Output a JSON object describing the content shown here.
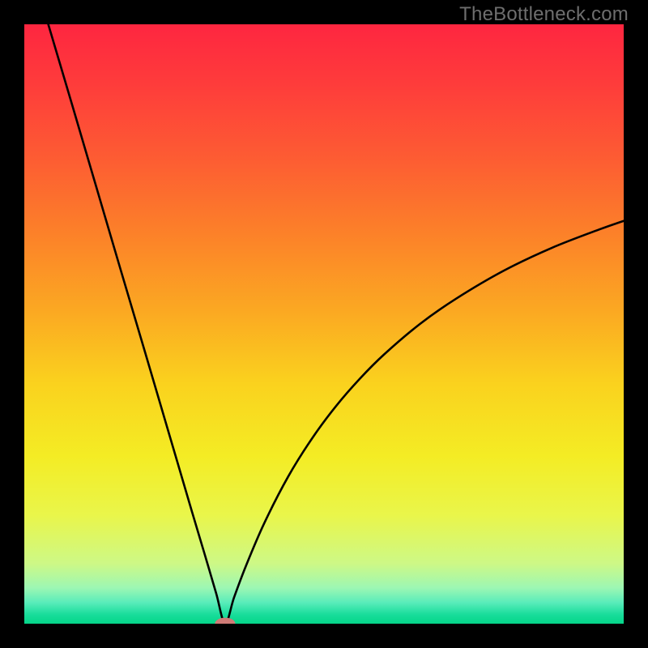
{
  "watermark": "TheBottleneck.com",
  "chart_data": {
    "type": "line",
    "title": "",
    "xlabel": "",
    "ylabel": "",
    "xlim": [
      0,
      1
    ],
    "ylim": [
      0,
      1
    ],
    "x_min_at": 0.335,
    "series": [
      {
        "name": "curve",
        "color": "#000000",
        "x": [
          0.04,
          0.08,
          0.12,
          0.16,
          0.2,
          0.24,
          0.28,
          0.3,
          0.32,
          0.335,
          0.35,
          0.37,
          0.4,
          0.44,
          0.48,
          0.52,
          0.56,
          0.6,
          0.66,
          0.72,
          0.8,
          0.88,
          0.96,
          1.0
        ],
        "y": [
          1.0,
          0.865,
          0.729,
          0.593,
          0.458,
          0.322,
          0.186,
          0.119,
          0.051,
          0.0,
          0.044,
          0.097,
          0.167,
          0.245,
          0.309,
          0.363,
          0.409,
          0.449,
          0.5,
          0.542,
          0.589,
          0.627,
          0.658,
          0.672
        ]
      }
    ],
    "marker": {
      "x": 0.335,
      "y": 0.0,
      "rx": 0.017,
      "ry": 0.01,
      "color": "#cf7b76"
    },
    "gradient_stops": [
      {
        "offset": 0.0,
        "color": "#fe2640"
      },
      {
        "offset": 0.1,
        "color": "#fe3c3b"
      },
      {
        "offset": 0.22,
        "color": "#fd5b33"
      },
      {
        "offset": 0.35,
        "color": "#fc8129"
      },
      {
        "offset": 0.48,
        "color": "#fba922"
      },
      {
        "offset": 0.6,
        "color": "#fad21e"
      },
      {
        "offset": 0.72,
        "color": "#f4ec24"
      },
      {
        "offset": 0.82,
        "color": "#e9f64b"
      },
      {
        "offset": 0.9,
        "color": "#cdf886"
      },
      {
        "offset": 0.94,
        "color": "#9df7b3"
      },
      {
        "offset": 0.965,
        "color": "#58ecba"
      },
      {
        "offset": 0.985,
        "color": "#18dd9a"
      },
      {
        "offset": 1.0,
        "color": "#05d589"
      }
    ]
  }
}
